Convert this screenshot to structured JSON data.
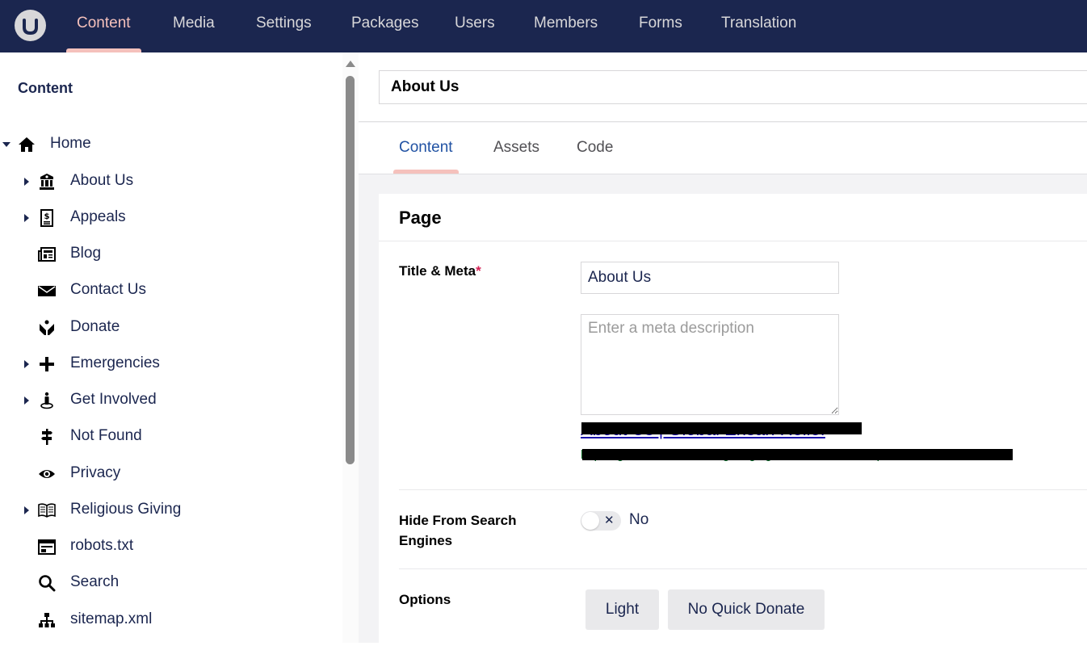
{
  "topnav": {
    "items": [
      {
        "label": "Content",
        "active": true
      },
      {
        "label": "Media"
      },
      {
        "label": "Settings"
      },
      {
        "label": "Packages"
      },
      {
        "label": "Users"
      },
      {
        "label": "Members"
      },
      {
        "label": "Forms"
      },
      {
        "label": "Translation"
      }
    ]
  },
  "sidebar": {
    "title": "Content",
    "tree": [
      {
        "label": "Home",
        "icon": "home-icon",
        "expanded": true,
        "level": 0
      },
      {
        "label": "About Us",
        "icon": "bank-icon",
        "has_children": true,
        "level": 1
      },
      {
        "label": "Appeals",
        "icon": "receipt-dollar-icon",
        "has_children": true,
        "level": 1
      },
      {
        "label": "Blog",
        "icon": "newspaper-icon",
        "level": 1
      },
      {
        "label": "Contact Us",
        "icon": "envelope-icon",
        "level": 1
      },
      {
        "label": "Donate",
        "icon": "donate-hands-icon",
        "level": 1
      },
      {
        "label": "Emergencies",
        "icon": "plus-icon",
        "has_children": true,
        "level": 1
      },
      {
        "label": "Get Involved",
        "icon": "person-standing-icon",
        "has_children": true,
        "level": 1
      },
      {
        "label": "Not Found",
        "icon": "signpost-icon",
        "level": 1
      },
      {
        "label": "Privacy",
        "icon": "eye-icon",
        "level": 1
      },
      {
        "label": "Religious Giving",
        "icon": "book-open-icon",
        "has_children": true,
        "level": 1
      },
      {
        "label": "robots.txt",
        "icon": "document-window-icon",
        "level": 1
      },
      {
        "label": "Search",
        "icon": "search-icon",
        "level": 1
      },
      {
        "label": "sitemap.xml",
        "icon": "sitemap-icon",
        "level": 1
      }
    ]
  },
  "editor": {
    "node_name": "About Us",
    "tabs": [
      {
        "label": "Content",
        "active": true
      },
      {
        "label": "Assets"
      },
      {
        "label": "Code"
      }
    ],
    "panel": {
      "title": "Page",
      "title_meta": {
        "label": "Title & Meta",
        "required_marker": "*",
        "title_value": "About Us",
        "description_placeholder": "Enter a meta description",
        "description_value": "",
        "preview_title": "About Us | Global Ehsan Relief",
        "preview_url": "https://globalehsanrelief.org/staging/...: This item is not published"
      },
      "hide_from_search": {
        "label": "Hide From Search Engines",
        "value": "No",
        "checked": false
      },
      "options": {
        "label": "Options",
        "buttons": [
          "Light",
          "No Quick Donate"
        ]
      }
    }
  },
  "colors": {
    "topbar": "#1b264f",
    "active_accent": "#f5c1bc",
    "tab_active_text": "#2152a3",
    "required": "#d42054"
  }
}
